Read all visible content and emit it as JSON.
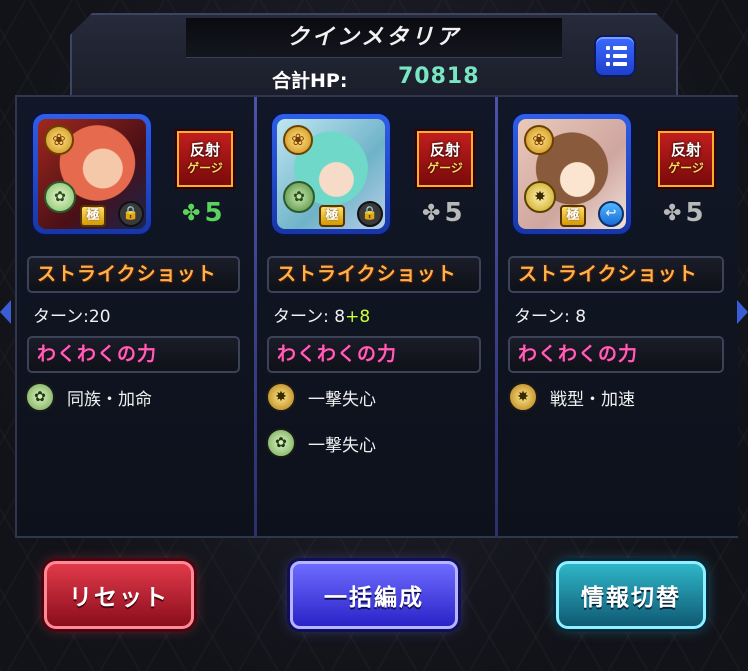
{
  "header": {
    "title": "クインメタリア",
    "hp_label": "合計HP:",
    "hp_value": "70818",
    "menu_icon": "list-menu-icon"
  },
  "columns": [
    {
      "reflect_badge": {
        "top": "反射",
        "bottom": "ゲージ"
      },
      "luck_value": "5",
      "luck_color": "#5ad45a",
      "strike_shot_name": "ストライクショット",
      "turn_label": "ターン:20",
      "turn_bonus": "",
      "gimmick_name": "わくわくの力",
      "abilities": [
        "同族・加命"
      ]
    },
    {
      "reflect_badge": {
        "top": "反射",
        "bottom": "ゲージ"
      },
      "luck_value": "5",
      "luck_color": "#b9b9b9",
      "strike_shot_name": "ストライクショット",
      "turn_label": "ターン: 8",
      "turn_bonus": "+8",
      "gimmick_name": "わくわくの力",
      "abilities": [
        "一撃失心",
        "一撃失心"
      ]
    },
    {
      "reflect_badge": {
        "top": "反射",
        "bottom": "ゲージ"
      },
      "luck_value": "5",
      "luck_color": "#b9b9b9",
      "strike_shot_name": "ストライクショット",
      "turn_label": "ターン: 8",
      "turn_bonus": "",
      "gimmick_name": "わくわくの力",
      "abilities": [
        "戦型・加速"
      ]
    }
  ],
  "buttons": {
    "reset": "リセット",
    "bulk_form": "一括編成",
    "info_switch": "情報切替"
  },
  "portrait_badges": {
    "rank": "極"
  },
  "colors": {
    "strike_shot": "#ffb24a",
    "gimmick": "#ff5fb6",
    "hp_value": "#79e6c2",
    "turn_bonus": "#c9ff3a"
  }
}
